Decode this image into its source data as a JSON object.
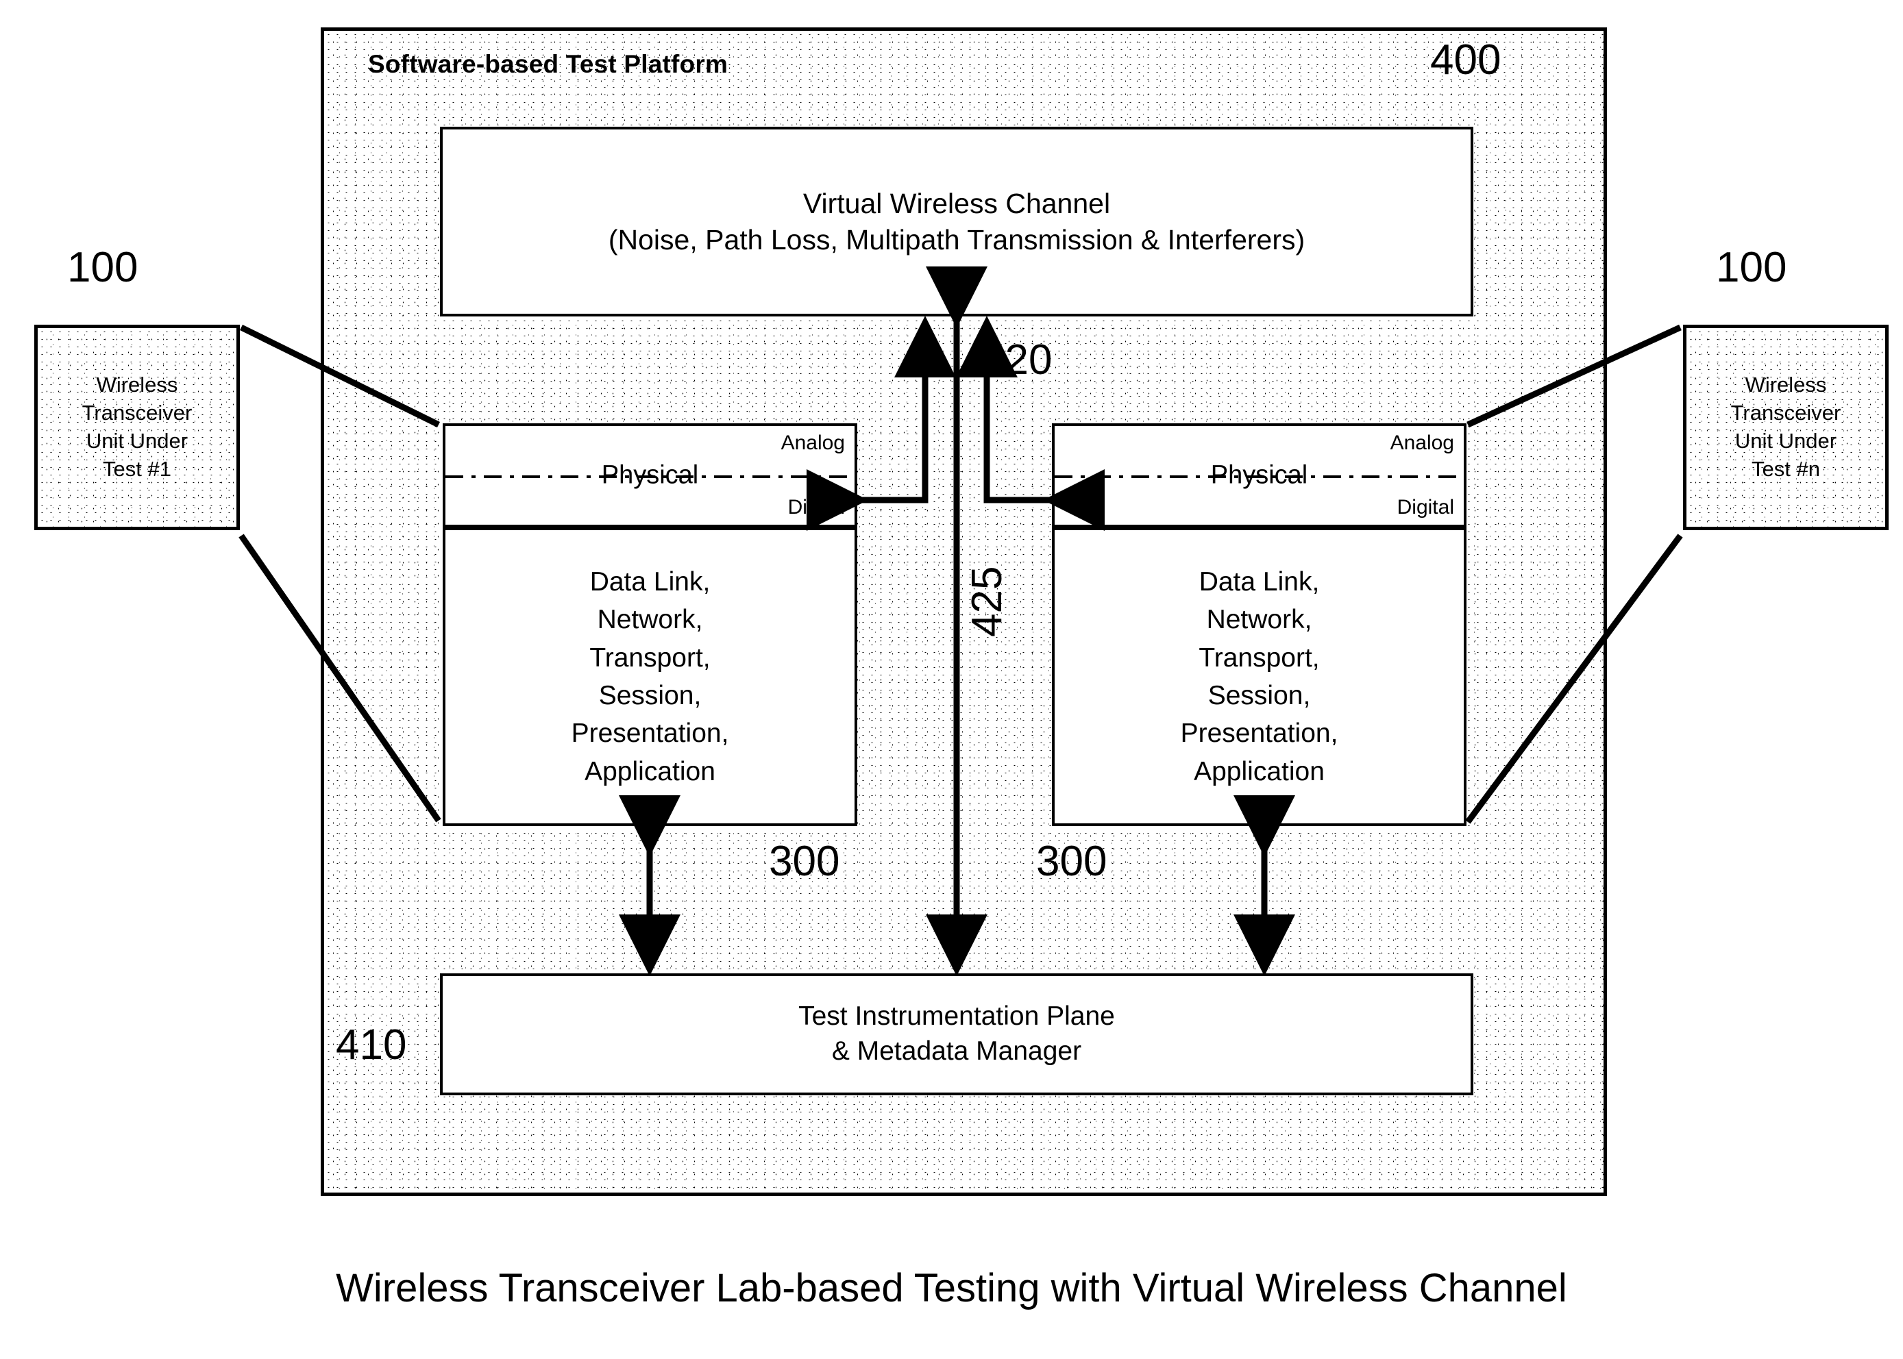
{
  "figure": {
    "caption": "Wireless Transceiver Lab-based Testing with Virtual Wireless Channel"
  },
  "platform": {
    "title": "Software-based Test Platform",
    "ref": "400"
  },
  "virtual_channel": {
    "line1": "Virtual Wireless Channel",
    "line2": "(Noise, Path Loss, Multipath Transmission & Interferers)",
    "ref": "420"
  },
  "channel_bus": {
    "ref": "425"
  },
  "physical_layer": {
    "label": "Physical",
    "analog": "Analog",
    "digital": "Digital"
  },
  "protocol_stack": {
    "text": "Data Link,\nNetwork,\nTransport,\nSession,\nPresentation,\nApplication",
    "ref_left": "300",
    "ref_right": "300"
  },
  "instrumentation": {
    "line1": "Test Instrumentation Plane",
    "line2": "& Metadata Manager",
    "ref": "410"
  },
  "uut_left": {
    "text": "Wireless\nTransceiver\nUnit Under\nTest #1",
    "ref": "100"
  },
  "uut_right": {
    "text": "Wireless\nTransceiver\nUnit Under\nTest #n",
    "ref": "100"
  },
  "colors": {
    "ink": "#000000",
    "paper": "#ffffff",
    "stipple": "#000000"
  }
}
